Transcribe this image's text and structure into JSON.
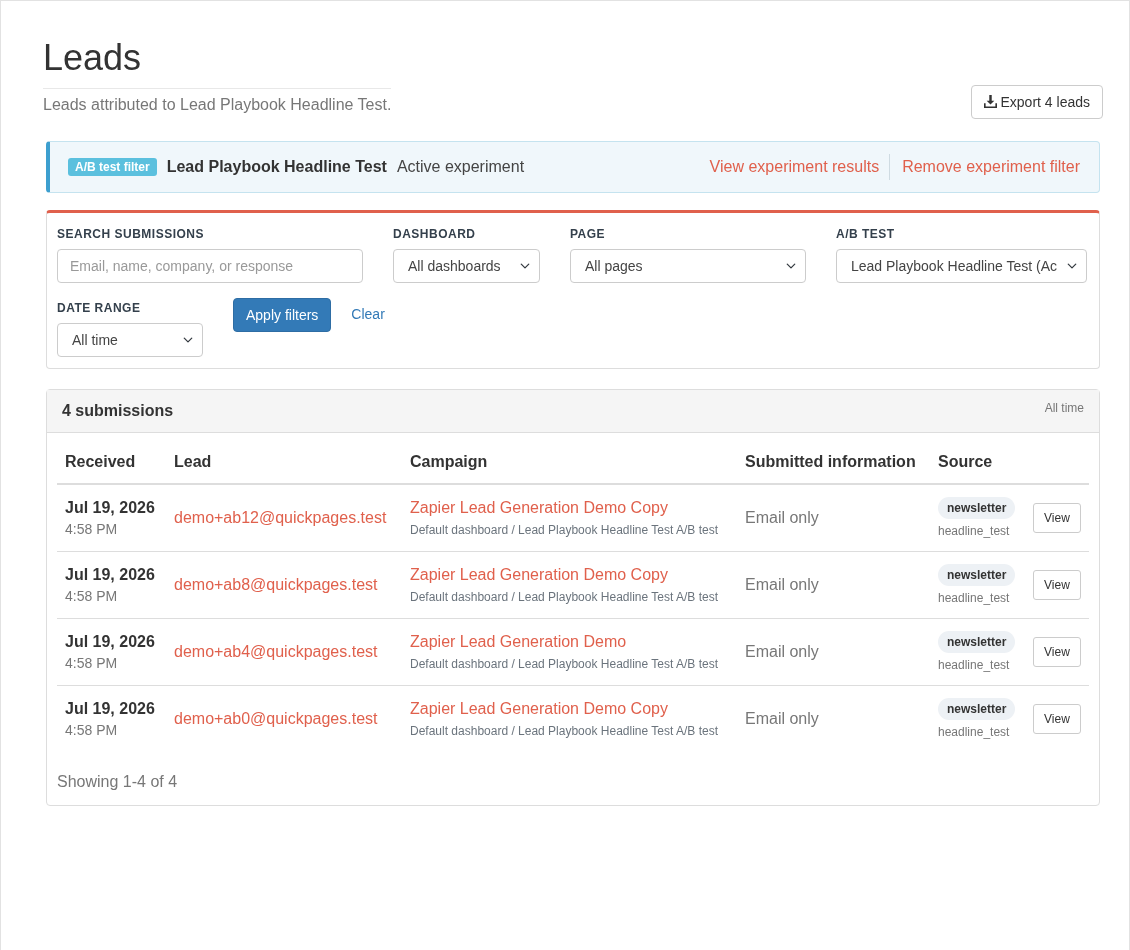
{
  "header": {
    "title": "Leads",
    "subtitle": "Leads attributed to Lead Playbook Headline Test.",
    "export_button": "Export 4 leads"
  },
  "experiment_filter": {
    "badge": "A/B test filter",
    "name": "Lead Playbook Headline Test",
    "status": "Active experiment",
    "links": [
      "View experiment results",
      "Remove experiment filter"
    ]
  },
  "filters": {
    "fields": [
      {
        "kind": "text",
        "label": "SEARCH SUBMISSIONS",
        "placeholder": "Email, name, company, or response"
      },
      {
        "kind": "select",
        "label": "DASHBOARD",
        "value": "All dashboards"
      },
      {
        "kind": "select",
        "label": "PAGE",
        "value": "All pages"
      },
      {
        "kind": "select",
        "label": "A/B TEST",
        "value": "Lead Playbook Headline Test (Ac"
      },
      {
        "kind": "select",
        "label": "DATE RANGE",
        "value": "All time"
      }
    ],
    "apply_button": "Apply filters",
    "clear_link": "Clear"
  },
  "results": {
    "title": "4 submissions",
    "range": "All time",
    "columns": [
      "Received",
      "Lead",
      "Campaign",
      "Submitted information",
      "Source"
    ],
    "rows": [
      {
        "date": "Jul 19, 2026",
        "time": "4:58 PM",
        "lead": "demo+ab12@quickpages.test",
        "campaign": "Zapier Lead Generation Demo Copy",
        "campaign_path": "Default dashboard / Lead Playbook Headline Test A/B test",
        "submitted": "Email only",
        "source": "newsletter",
        "source_detail": "headline_test",
        "action": "View"
      },
      {
        "date": "Jul 19, 2026",
        "time": "4:58 PM",
        "lead": "demo+ab8@quickpages.test",
        "campaign": "Zapier Lead Generation Demo Copy",
        "campaign_path": "Default dashboard / Lead Playbook Headline Test A/B test",
        "submitted": "Email only",
        "source": "newsletter",
        "source_detail": "headline_test",
        "action": "View"
      },
      {
        "date": "Jul 19, 2026",
        "time": "4:58 PM",
        "lead": "demo+ab4@quickpages.test",
        "campaign": "Zapier Lead Generation Demo",
        "campaign_path": "Default dashboard / Lead Playbook Headline Test A/B test",
        "submitted": "Email only",
        "source": "newsletter",
        "source_detail": "headline_test",
        "action": "View"
      },
      {
        "date": "Jul 19, 2026",
        "time": "4:58 PM",
        "lead": "demo+ab0@quickpages.test",
        "campaign": "Zapier Lead Generation Demo Copy",
        "campaign_path": "Default dashboard / Lead Playbook Headline Test A/B test",
        "submitted": "Email only",
        "source": "newsletter",
        "source_detail": "headline_test",
        "action": "View"
      }
    ],
    "footer": "Showing 1-4 of 4"
  }
}
